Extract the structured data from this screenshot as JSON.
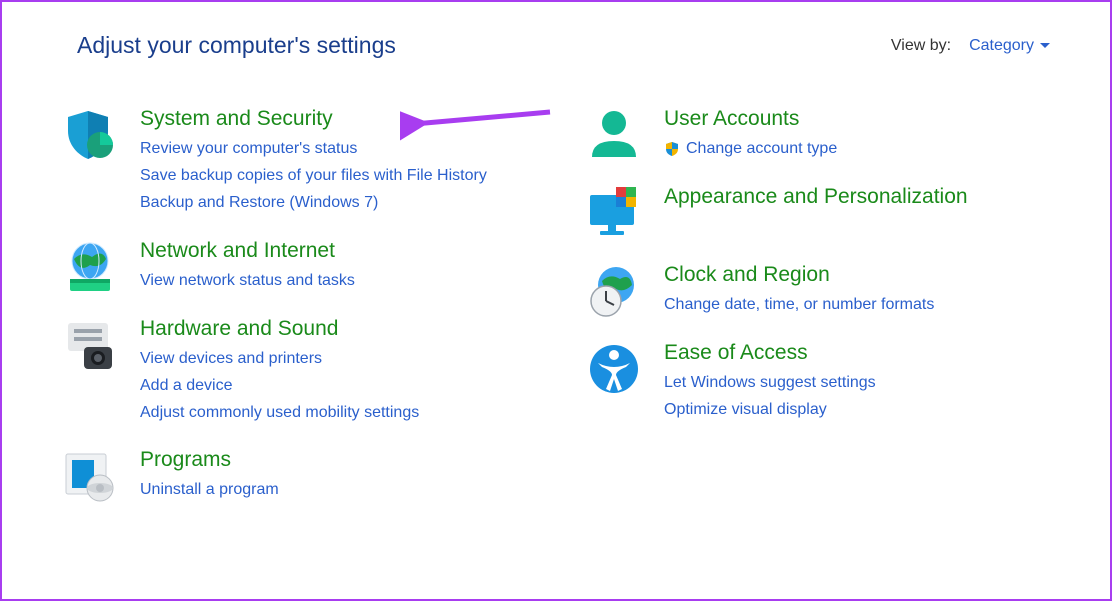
{
  "header": {
    "title": "Adjust your computer's settings",
    "viewby_label": "View by:",
    "viewby_value": "Category"
  },
  "left": [
    {
      "title": "System and Security",
      "links": [
        "Review your computer's status",
        "Save backup copies of your files with File History",
        "Backup and Restore (Windows 7)"
      ]
    },
    {
      "title": "Network and Internet",
      "links": [
        "View network status and tasks"
      ]
    },
    {
      "title": "Hardware and Sound",
      "links": [
        "View devices and printers",
        "Add a device",
        "Adjust commonly used mobility settings"
      ]
    },
    {
      "title": "Programs",
      "links": [
        "Uninstall a program"
      ]
    }
  ],
  "right": [
    {
      "title": "User Accounts",
      "links": [
        "Change account type"
      ],
      "shielded": [
        true
      ]
    },
    {
      "title": "Appearance and Personalization",
      "links": []
    },
    {
      "title": "Clock and Region",
      "links": [
        "Change date, time, or number formats"
      ]
    },
    {
      "title": "Ease of Access",
      "links": [
        "Let Windows suggest settings",
        "Optimize visual display"
      ]
    }
  ]
}
